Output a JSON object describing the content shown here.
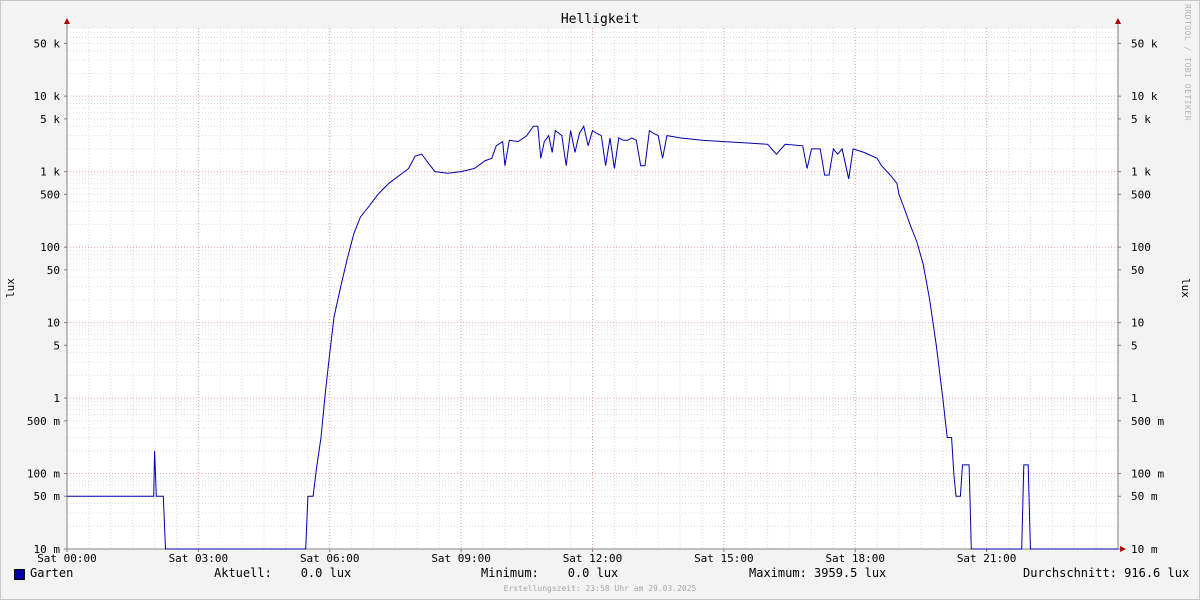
{
  "chart_data": {
    "type": "line",
    "title": "Helligkeit",
    "ylabel": "lux",
    "yscale": "log",
    "ylim": [
      0.01,
      80000
    ],
    "x_range_hours": [
      0,
      24
    ],
    "x_ticks": [
      {
        "h": 0,
        "label": "Sat 00:00"
      },
      {
        "h": 3,
        "label": "Sat 03:00"
      },
      {
        "h": 6,
        "label": "Sat 06:00"
      },
      {
        "h": 9,
        "label": "Sat 09:00"
      },
      {
        "h": 12,
        "label": "Sat 12:00"
      },
      {
        "h": 15,
        "label": "Sat 15:00"
      },
      {
        "h": 18,
        "label": "Sat 18:00"
      },
      {
        "h": 21,
        "label": "Sat 21:00"
      }
    ],
    "y_ticks": [
      {
        "v": 0.01,
        "label": "10 m"
      },
      {
        "v": 0.05,
        "label": "50 m"
      },
      {
        "v": 0.1,
        "label": "100 m"
      },
      {
        "v": 0.5,
        "label": "500 m"
      },
      {
        "v": 1,
        "label": "1"
      },
      {
        "v": 5,
        "label": "5"
      },
      {
        "v": 10,
        "label": "10"
      },
      {
        "v": 50,
        "label": "50"
      },
      {
        "v": 100,
        "label": "100"
      },
      {
        "v": 500,
        "label": "500"
      },
      {
        "v": 1000,
        "label": "1 k"
      },
      {
        "v": 5000,
        "label": "5 k"
      },
      {
        "v": 10000,
        "label": "10 k"
      },
      {
        "v": 50000,
        "label": "50 k"
      }
    ],
    "grid": true,
    "series": [
      {
        "name": "Garten",
        "color": "#0000aa",
        "points": [
          [
            0.0,
            0.05
          ],
          [
            1.98,
            0.05
          ],
          [
            2.0,
            0.2
          ],
          [
            2.04,
            0.05
          ],
          [
            2.2,
            0.05
          ],
          [
            2.25,
            0.01
          ],
          [
            5.45,
            0.01
          ],
          [
            5.5,
            0.05
          ],
          [
            5.62,
            0.05
          ],
          [
            5.7,
            0.12
          ],
          [
            5.8,
            0.3
          ],
          [
            5.9,
            1.2
          ],
          [
            6.0,
            4
          ],
          [
            6.1,
            12
          ],
          [
            6.25,
            30
          ],
          [
            6.4,
            70
          ],
          [
            6.55,
            150
          ],
          [
            6.7,
            250
          ],
          [
            6.9,
            350
          ],
          [
            7.1,
            500
          ],
          [
            7.35,
            700
          ],
          [
            7.6,
            900
          ],
          [
            7.8,
            1100
          ],
          [
            7.95,
            1600
          ],
          [
            8.1,
            1700
          ],
          [
            8.25,
            1300
          ],
          [
            8.4,
            1000
          ],
          [
            8.7,
            950
          ],
          [
            9.0,
            1000
          ],
          [
            9.3,
            1100
          ],
          [
            9.55,
            1400
          ],
          [
            9.7,
            1500
          ],
          [
            9.8,
            2200
          ],
          [
            9.95,
            2500
          ],
          [
            10.0,
            1200
          ],
          [
            10.1,
            2600
          ],
          [
            10.3,
            2500
          ],
          [
            10.5,
            3000
          ],
          [
            10.65,
            4000
          ],
          [
            10.75,
            4000
          ],
          [
            10.82,
            1500
          ],
          [
            10.9,
            2500
          ],
          [
            11.0,
            3000
          ],
          [
            11.08,
            1800
          ],
          [
            11.15,
            3500
          ],
          [
            11.3,
            3000
          ],
          [
            11.4,
            1200
          ],
          [
            11.5,
            3500
          ],
          [
            11.6,
            1800
          ],
          [
            11.7,
            3200
          ],
          [
            11.8,
            4000
          ],
          [
            11.9,
            2200
          ],
          [
            12.0,
            3500
          ],
          [
            12.1,
            3200
          ],
          [
            12.2,
            3000
          ],
          [
            12.3,
            1200
          ],
          [
            12.4,
            2800
          ],
          [
            12.5,
            1100
          ],
          [
            12.6,
            2800
          ],
          [
            12.7,
            2600
          ],
          [
            12.8,
            2600
          ],
          [
            12.9,
            2800
          ],
          [
            13.0,
            2600
          ],
          [
            13.1,
            1200
          ],
          [
            13.2,
            1200
          ],
          [
            13.3,
            3500
          ],
          [
            13.4,
            3200
          ],
          [
            13.5,
            3000
          ],
          [
            13.6,
            1500
          ],
          [
            13.7,
            3000
          ],
          [
            14.0,
            2800
          ],
          [
            14.5,
            2600
          ],
          [
            15.0,
            2500
          ],
          [
            15.5,
            2400
          ],
          [
            16.0,
            2300
          ],
          [
            16.2,
            1700
          ],
          [
            16.4,
            2300
          ],
          [
            16.8,
            2200
          ],
          [
            16.9,
            1100
          ],
          [
            17.0,
            2000
          ],
          [
            17.2,
            2000
          ],
          [
            17.3,
            900
          ],
          [
            17.4,
            900
          ],
          [
            17.5,
            2000
          ],
          [
            17.6,
            1700
          ],
          [
            17.7,
            2000
          ],
          [
            17.85,
            800
          ],
          [
            17.95,
            2000
          ],
          [
            18.2,
            1800
          ],
          [
            18.5,
            1500
          ],
          [
            18.6,
            1200
          ],
          [
            18.8,
            900
          ],
          [
            18.95,
            700
          ],
          [
            19.0,
            500
          ],
          [
            19.1,
            350
          ],
          [
            19.25,
            200
          ],
          [
            19.4,
            120
          ],
          [
            19.55,
            60
          ],
          [
            19.7,
            20
          ],
          [
            19.85,
            5
          ],
          [
            20.0,
            1
          ],
          [
            20.1,
            0.3
          ],
          [
            20.2,
            0.3
          ],
          [
            20.25,
            0.1
          ],
          [
            20.3,
            0.05
          ],
          [
            20.4,
            0.05
          ],
          [
            20.45,
            0.13
          ],
          [
            20.6,
            0.13
          ],
          [
            20.65,
            0.01
          ],
          [
            21.8,
            0.01
          ],
          [
            21.85,
            0.13
          ],
          [
            21.95,
            0.13
          ],
          [
            22.0,
            0.01
          ],
          [
            24.0,
            0.01
          ]
        ]
      }
    ]
  },
  "legend": {
    "series_name": "Garten",
    "current": "Aktuell:    0.0 lux",
    "minimum": "Minimum:    0.0 lux",
    "maximum": "Maximum: 3959.5 lux",
    "average": "Durchschnitt: 916.6 lux"
  },
  "footer": "Erstellungszeit: 23:58 Uhr am 29.03.2025",
  "watermark": "RRDTOOL / TOBI OETIKER"
}
